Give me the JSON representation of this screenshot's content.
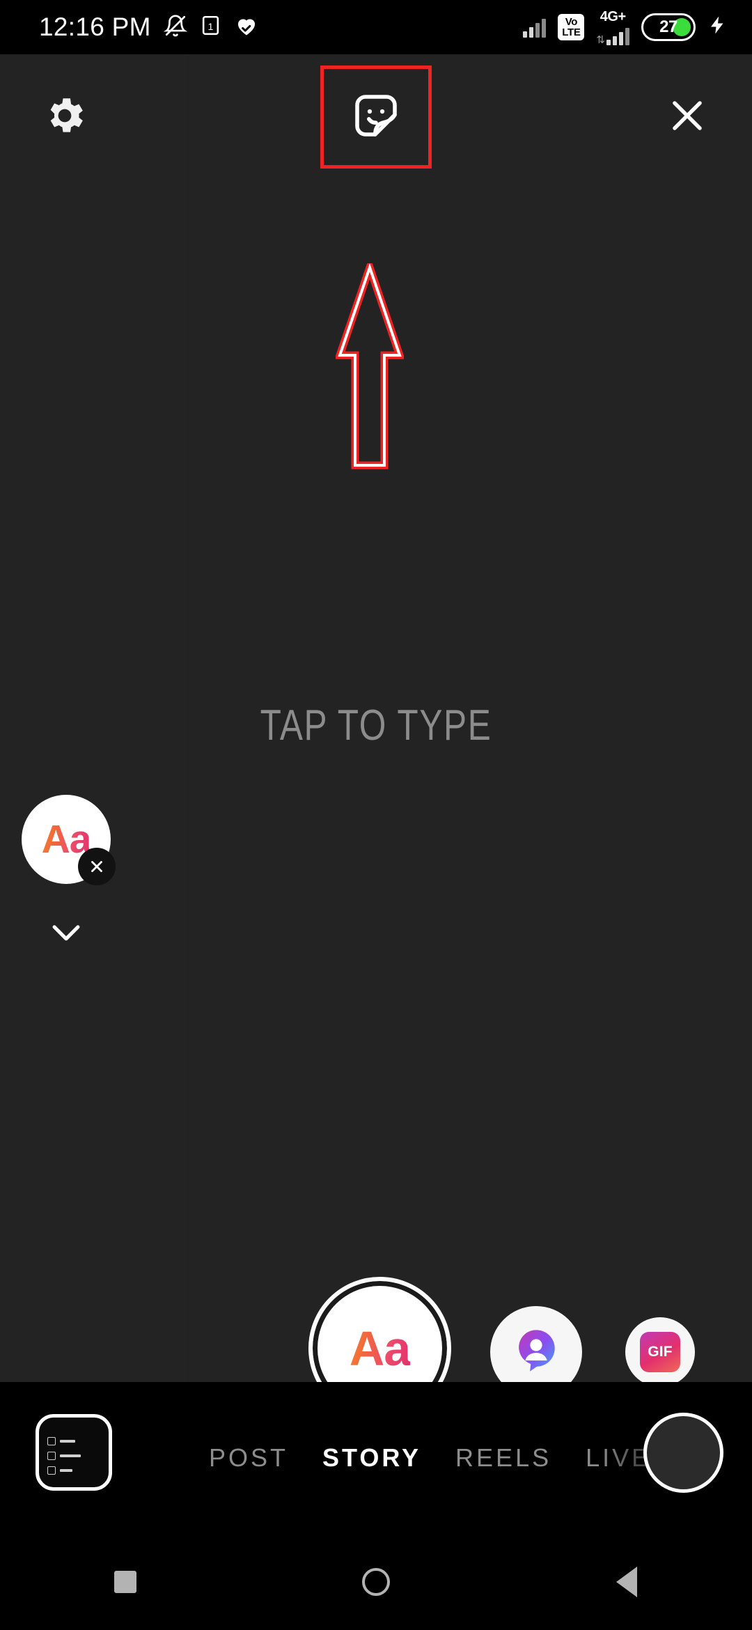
{
  "status_bar": {
    "time": "12:16 PM",
    "icons": {
      "mute": "notifications-off-icon",
      "sim": "sim-card-1-icon",
      "health": "heart-check-icon"
    },
    "sim1_signal": "signal-bars-icon",
    "volte_line1": "Vo",
    "volte_line2": "LTE",
    "network_label": "4G+",
    "data_arrows": "⇅",
    "sim2_signal": "signal-bars-icon",
    "battery_percent": "27",
    "charging": "charging-bolt-icon"
  },
  "toolbar": {
    "settings_label": "gear-icon",
    "sticker_label": "sticker-icon",
    "close_label": "close-icon",
    "highlight_color": "#ee2424"
  },
  "annotation": {
    "arrow": "up-arrow-annotation",
    "arrow_stroke": "#ee2424",
    "arrow_inner": "#ffffff"
  },
  "canvas": {
    "placeholder": "TAP TO TYPE",
    "placeholder_color": "#8c8c8c",
    "background": "#232323"
  },
  "font_chip": {
    "label": "Aa",
    "remove_label": "×",
    "expand_label": "chevron-down-icon"
  },
  "tools": [
    {
      "name": "text-tool",
      "label": "Aa",
      "selected": true
    },
    {
      "name": "mention-tool",
      "label": "avatar-icon",
      "selected": false
    },
    {
      "name": "gif-tool",
      "label": "GIF",
      "selected": false
    }
  ],
  "bottom_bar": {
    "gallery_label": "gallery-thumbnail",
    "modes": [
      {
        "label": "POST",
        "active": false
      },
      {
        "label": "STORY",
        "active": true
      },
      {
        "label": "REELS",
        "active": false
      },
      {
        "label": "LIVE",
        "active": false
      }
    ],
    "shutter_label": "shutter-button"
  },
  "nav_bar": {
    "recents": "recents-square-icon",
    "home": "home-circle-icon",
    "back": "back-triangle-icon"
  }
}
